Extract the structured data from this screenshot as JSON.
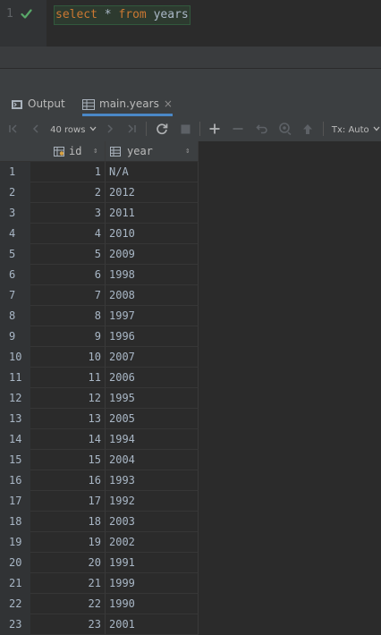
{
  "editor": {
    "line_number": "1",
    "status_icon": "check-icon",
    "code": {
      "kw1": "select",
      "op": " * ",
      "kw2": "from",
      "table": "years"
    }
  },
  "tabs": [
    {
      "label": "Output",
      "icon": "output-icon",
      "active": false
    },
    {
      "label": "main.years",
      "icon": "table-icon",
      "active": true,
      "close": "×"
    }
  ],
  "toolbar": {
    "rows_label": "40 rows",
    "tx_label": "Tx: Auto"
  },
  "table": {
    "columns": [
      {
        "name": "id",
        "icon": "key-column-icon"
      },
      {
        "name": "year",
        "icon": "column-icon"
      }
    ],
    "rows": [
      {
        "n": "1",
        "id": "1",
        "year": "N/A"
      },
      {
        "n": "2",
        "id": "2",
        "year": "2012"
      },
      {
        "n": "3",
        "id": "3",
        "year": "2011"
      },
      {
        "n": "4",
        "id": "4",
        "year": "2010"
      },
      {
        "n": "5",
        "id": "5",
        "year": "2009"
      },
      {
        "n": "6",
        "id": "6",
        "year": "1998"
      },
      {
        "n": "7",
        "id": "7",
        "year": "2008"
      },
      {
        "n": "8",
        "id": "8",
        "year": "1997"
      },
      {
        "n": "9",
        "id": "9",
        "year": "1996"
      },
      {
        "n": "10",
        "id": "10",
        "year": "2007"
      },
      {
        "n": "11",
        "id": "11",
        "year": "2006"
      },
      {
        "n": "12",
        "id": "12",
        "year": "1995"
      },
      {
        "n": "13",
        "id": "13",
        "year": "2005"
      },
      {
        "n": "14",
        "id": "14",
        "year": "1994"
      },
      {
        "n": "15",
        "id": "15",
        "year": "2004"
      },
      {
        "n": "16",
        "id": "16",
        "year": "1993"
      },
      {
        "n": "17",
        "id": "17",
        "year": "1992"
      },
      {
        "n": "18",
        "id": "18",
        "year": "2003"
      },
      {
        "n": "19",
        "id": "19",
        "year": "2002"
      },
      {
        "n": "20",
        "id": "20",
        "year": "1991"
      },
      {
        "n": "21",
        "id": "21",
        "year": "1999"
      },
      {
        "n": "22",
        "id": "22",
        "year": "1990"
      },
      {
        "n": "23",
        "id": "23",
        "year": "2001"
      }
    ]
  },
  "colors": {
    "background": "#2b2b2b",
    "keyword": "#cc7832",
    "check": "#59a869",
    "active_tab": "#4a88c7"
  }
}
